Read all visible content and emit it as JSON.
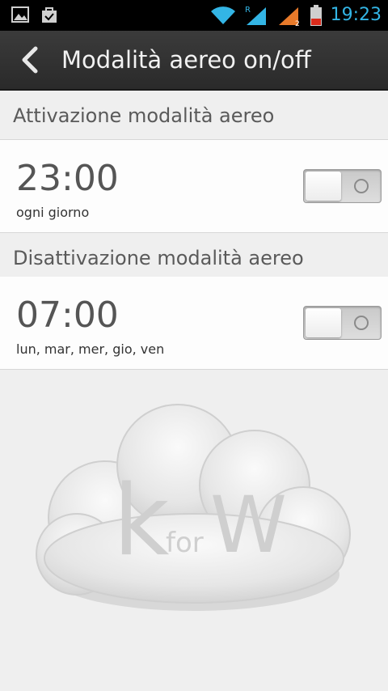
{
  "status_bar": {
    "time": "19:23",
    "icons": [
      "gallery-icon",
      "shopping-bag-icon",
      "wifi-icon",
      "signal-roaming-icon",
      "signal-icon",
      "battery-icon"
    ],
    "accent": "#33b5e5"
  },
  "action_bar": {
    "title": "Modalità aereo on/off",
    "back_icon": "chevron-left-icon"
  },
  "sections": [
    {
      "header": "Attivazione modalità aereo",
      "time": "23:00",
      "days": "ogni giorno",
      "enabled": false
    },
    {
      "header": "Disattivazione modalità aereo",
      "time": "07:00",
      "days": "lun, mar, mer, gio, ven",
      "enabled": false
    }
  ],
  "watermark": {
    "text_k": "k",
    "text_for": "for",
    "text_w": "W",
    "icon": "cloud-logo"
  }
}
